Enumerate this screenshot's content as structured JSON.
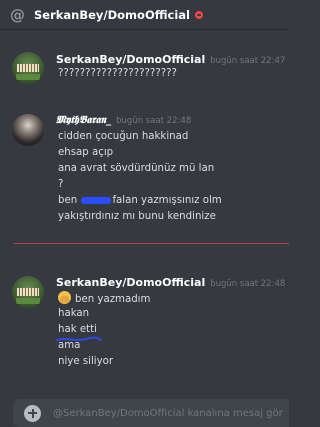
{
  "header": {
    "at_symbol": "@",
    "channel_name": "SerkanBey/DomoOfficial",
    "status_color": "#f04747"
  },
  "messages": [
    {
      "author": "SerkanBey/DomoOfficial",
      "timestamp": "bugün saat 22:47",
      "lines": [
        "??????????????????????"
      ]
    },
    {
      "author": "𝕸𝖞𝖙𝖍𝕭𝖆𝖗𝖆𝖓_",
      "timestamp": "bugün saat 22:48",
      "lines": [
        "cidden çocuğun hakkinad",
        "ehsap açıp",
        "ana avrat sövdürdünüz mü lan",
        "?",
        "ben",
        "falan yazmışsınız olm",
        "yakıştırdınız mı bunu kendinize"
      ]
    },
    {
      "author": "SerkanBey/DomoOfficial",
      "timestamp": "bugün saat 22:48",
      "lines": [
        "ben yazmadım",
        "hakan",
        "hak etti",
        "ama",
        "niye siliyor"
      ]
    }
  ],
  "composer": {
    "placeholder": "@SerkanBey/DomoOfficial kanalına mesaj gönder"
  },
  "colors": {
    "background": "#36393f",
    "divider": "#c4493f",
    "scribble": "#2a4cff"
  }
}
